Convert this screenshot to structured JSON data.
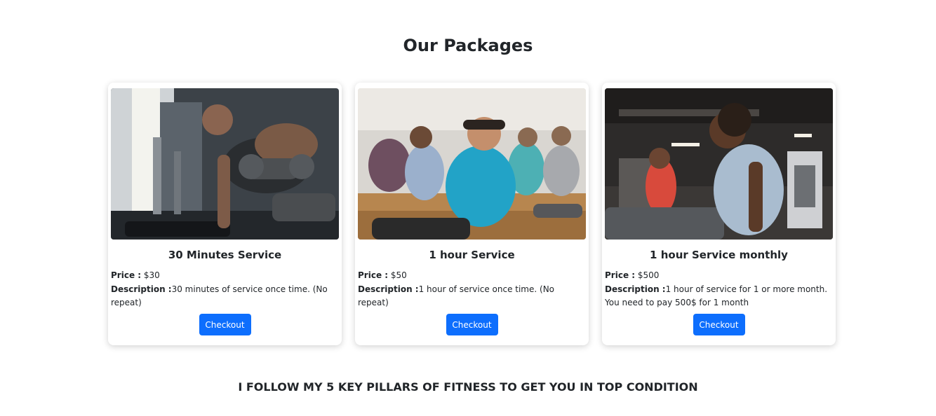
{
  "packages_section": {
    "title": "Our Packages",
    "packages": [
      {
        "name": "30 Minutes Service",
        "price_label": "Price :",
        "price": " $30",
        "description_label": "Description :",
        "description": "30 minutes of service once time. (No repeat)",
        "button": "Checkout",
        "image": "gym-dumbbell-row-photo"
      },
      {
        "name": "1 hour Service",
        "price_label": "Price :",
        "price": " $50",
        "description_label": "Description :",
        "description": "1 hour of service once time. (No repeat)",
        "button": "Checkout",
        "image": "group-situps-class-photo"
      },
      {
        "name": "1 hour Service monthly",
        "price_label": "Price :",
        "price": " $500",
        "description_label": "Description :",
        "description": "1 hour of service for 1 or more month. You need to pay 500$ for 1 month",
        "button": "Checkout",
        "image": "treadmill-running-photo"
      }
    ]
  },
  "pillars_heading": "I FOLLOW MY 5 KEY PILLARS OF FITNESS TO GET YOU IN TOP CONDITION",
  "colors": {
    "button": "#0d6efd",
    "text": "#212529",
    "background": "#ffffff"
  }
}
